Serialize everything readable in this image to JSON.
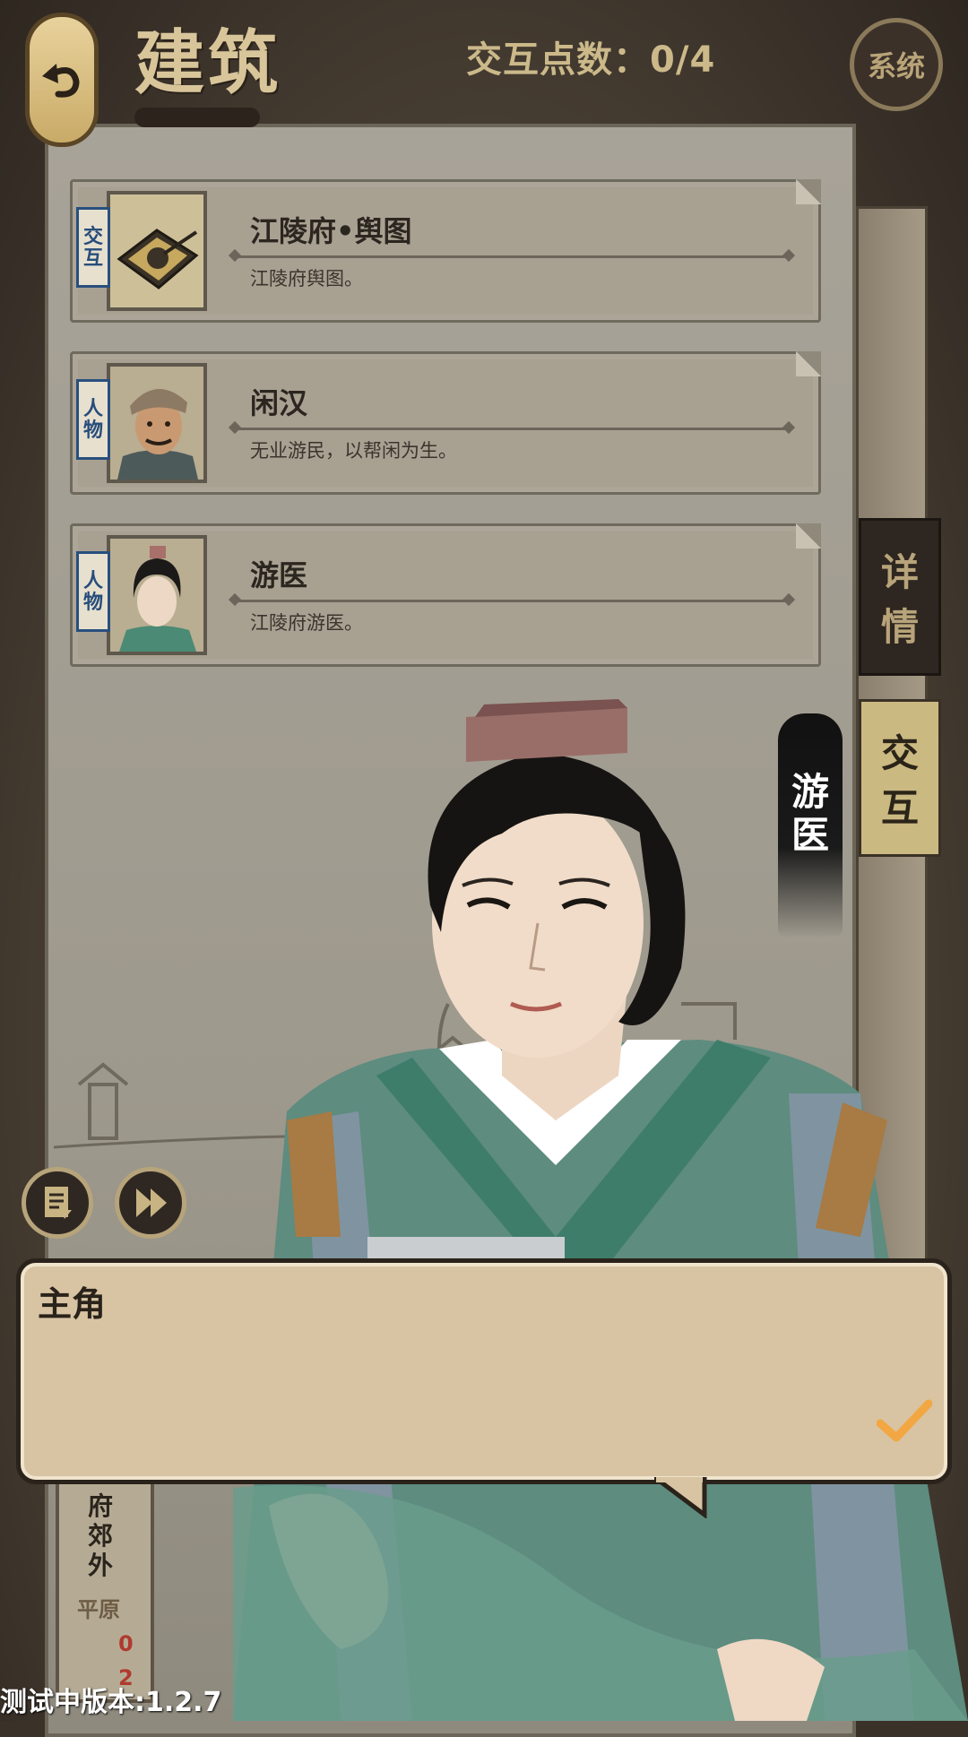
{
  "header": {
    "back_icon": "back-arrow-icon",
    "title": "建筑",
    "interaction_points": "交互点数：0/4",
    "system_label": "系统"
  },
  "cards": [
    {
      "tag": "交互",
      "tag_chars": [
        "交",
        "互"
      ],
      "name": "江陵府•舆图",
      "desc": "江陵府舆图。",
      "thumb_icon": "map-board-icon"
    },
    {
      "tag": "人物",
      "tag_chars": [
        "人",
        "物"
      ],
      "name": "闲汉",
      "desc": "无业游民，以帮闲为生。",
      "thumb_icon": "idler-portrait"
    },
    {
      "tag": "人物",
      "tag_chars": [
        "人",
        "物"
      ],
      "name": "游医",
      "desc": "江陵府游医。",
      "thumb_icon": "doctor-portrait"
    }
  ],
  "tabs": {
    "detail": [
      "详",
      "情"
    ],
    "interact": [
      "交",
      "互"
    ]
  },
  "character": {
    "name_chars": [
      "游",
      "医"
    ]
  },
  "controls": {
    "log_icon": "log-icon",
    "fast_forward_icon": "fast-forward-icon"
  },
  "side_panel": {
    "location_chars": [
      "府",
      "郊",
      "外"
    ],
    "terrain": "平原",
    "count_1": "0",
    "count_2": "2"
  },
  "dialog": {
    "speaker": "主角",
    "text": "",
    "confirm_icon": "check-icon"
  },
  "version": "测试中版本:1.2.7",
  "colors": {
    "panel": "#a8a398",
    "tag_blue": "#284f7e",
    "dialog_bg": "#d8c4a3",
    "tab_active": "#cbb982"
  }
}
